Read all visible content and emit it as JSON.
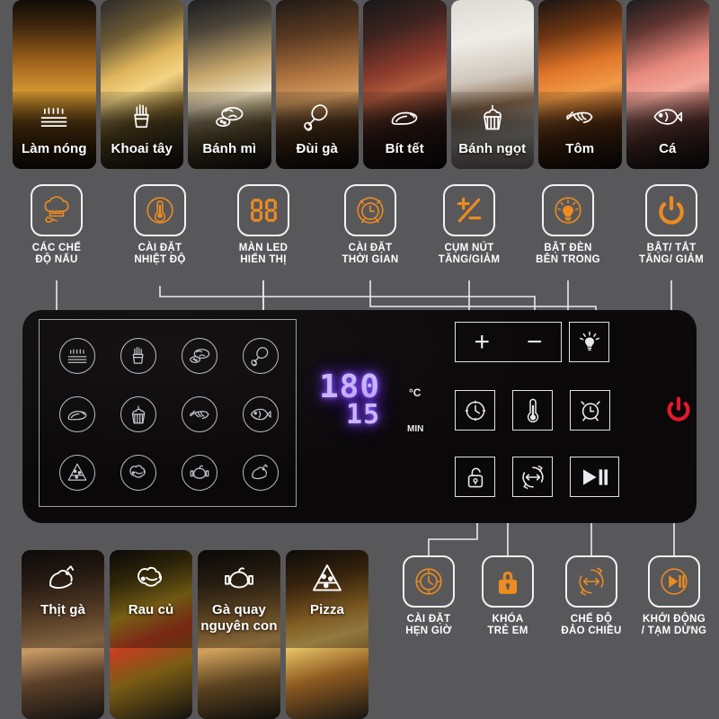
{
  "theme": {
    "background": "#58585a",
    "panel": "#0a0809",
    "accent": "#ed8b21",
    "outline": "#f2f2f2",
    "led": "#c9b6ff",
    "power_red": "#e8182b"
  },
  "top_presets": [
    {
      "name": "Làm nóng",
      "icon": "preheat-icon"
    },
    {
      "name": "Khoai tây",
      "icon": "fries-icon"
    },
    {
      "name": "Bánh mì",
      "icon": "bread-icon"
    },
    {
      "name": "Đùi gà",
      "icon": "drumstick-icon"
    },
    {
      "name": "Bít tết",
      "icon": "steak-icon"
    },
    {
      "name": "Bánh ngọt",
      "icon": "cupcake-icon"
    },
    {
      "name": "Tôm",
      "icon": "shrimp-icon"
    },
    {
      "name": "Cá",
      "icon": "fish-icon"
    }
  ],
  "bottom_presets": [
    {
      "name": "Thịt gà",
      "icon": "chicken-meat-icon"
    },
    {
      "name": "Rau củ",
      "icon": "vegetables-icon"
    },
    {
      "name": "Gà quay\nnguyên con",
      "icon": "whole-roast-chicken-icon"
    },
    {
      "name": "Pizza",
      "icon": "pizza-icon"
    }
  ],
  "top_callouts": [
    {
      "id": "cooking-modes",
      "icon": "chef-hat-icon",
      "line1": "CÁC CHẾ",
      "line2": "ĐỘ NẤU"
    },
    {
      "id": "temp-setting",
      "icon": "thermometer-icon",
      "line1": "CÀI ĐẶT",
      "line2": "NHIỆT ĐỘ"
    },
    {
      "id": "led-display",
      "icon": "seven-segment-icon",
      "line1": "MÀN LED",
      "line2": "HIỂN THỊ"
    },
    {
      "id": "time-setting",
      "icon": "alarm-clock-icon",
      "line1": "CÀI ĐẶT",
      "line2": "THỜI GIAN"
    },
    {
      "id": "plus-minus",
      "icon": "plus-minus-icon",
      "line1": "CỤM NÚT",
      "line2": "TĂNG/GIẢM"
    },
    {
      "id": "inner-light",
      "icon": "lightbulb-icon",
      "line1": "BẬT ĐÈN",
      "line2": "BÊN TRONG"
    },
    {
      "id": "power-onoff",
      "icon": "power-icon",
      "line1": "BẬT/ TẮT",
      "line2": "TĂNG/ GIẢM"
    }
  ],
  "bottom_callouts": [
    {
      "id": "timer-setting",
      "icon": "timer-icon",
      "line1": "CÀI ĐẶT",
      "line2": "HẸN GIỜ"
    },
    {
      "id": "child-lock",
      "icon": "padlock-icon",
      "line1": "KHÓA",
      "line2": "TRẺ EM"
    },
    {
      "id": "rotate-mode",
      "icon": "rotisserie-icon",
      "line1": "CHẾ ĐỘ",
      "line2": "ĐẢO CHIỀU"
    },
    {
      "id": "start-pause",
      "icon": "play-pause-icon",
      "line1": "KHỞI ĐỘNG",
      "line2": "/ TẠM DỪNG"
    }
  ],
  "mode_grid": [
    "preheat-icon",
    "fries-icon",
    "bread-icon",
    "drumstick-icon",
    "steak-icon",
    "cupcake-icon",
    "shrimp-icon",
    "fish-icon",
    "pizza-icon",
    "vegetables-icon",
    "whole-roast-chicken-icon",
    "chicken-meat-icon"
  ],
  "led": {
    "temperature": "180",
    "temperature_unit": "°C",
    "time": "15",
    "time_unit": "MIN"
  },
  "panel_keys": {
    "plus": "+",
    "minus": "−",
    "light": "lightbulb-icon",
    "timer": "clock-icon",
    "thermometer": "thermometer-icon",
    "alarm": "alarm-clock-icon",
    "lock": "padlock-open-icon",
    "rotate": "rotisserie-icon",
    "start_pause": "play-pause-icon",
    "power": "power-icon"
  }
}
